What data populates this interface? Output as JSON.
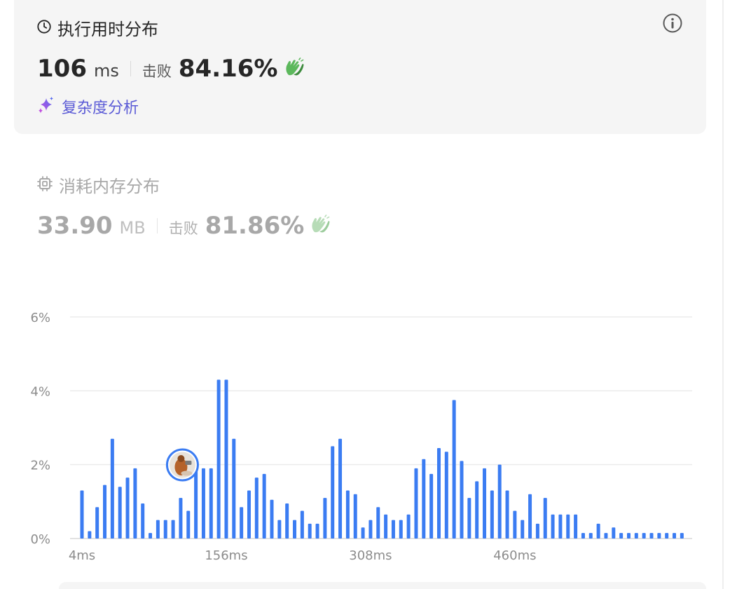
{
  "runtime": {
    "title": "执行用时分布",
    "value": "106",
    "unit": "ms",
    "beats_label": "击败",
    "beats_value": "84.16%",
    "analysis_label": "复杂度分析"
  },
  "memory": {
    "title": "消耗内存分布",
    "value": "33.90",
    "unit": "MB",
    "beats_label": "击败",
    "beats_value": "81.86%"
  },
  "colors": {
    "bar": "#3b7cf2",
    "accent_purple": "#7c5ce0",
    "clap_green": "#4caf50"
  },
  "icons": {
    "runtime": "clock-icon",
    "info": "info-icon",
    "analysis": "sparkle-icon",
    "memory": "chip-icon",
    "beats": "clapping-hands-icon",
    "marker": "user-avatar"
  },
  "chart_data": {
    "type": "bar",
    "title": "",
    "xlabel": "",
    "ylabel": "",
    "ylim": [
      0,
      6
    ],
    "yticks": [
      "0%",
      "2%",
      "4%",
      "6%"
    ],
    "xticks": [
      "4ms",
      "156ms",
      "308ms",
      "460ms"
    ],
    "x_tick_indices": [
      0,
      19,
      38,
      57
    ],
    "highlight_index": 13,
    "grid": true,
    "legend": "none",
    "series": [
      {
        "values": [
          1.3,
          0.2,
          0.85,
          1.45,
          2.7,
          1.4,
          1.65,
          1.9,
          0.95,
          0.15,
          0.5,
          0.5,
          0.5,
          1.1,
          0.75,
          2.05,
          1.9,
          1.9,
          4.3,
          4.3,
          2.7,
          0.85,
          1.3,
          1.65,
          1.75,
          1.05,
          0.5,
          0.95,
          0.5,
          0.75,
          0.4,
          0.4,
          1.1,
          2.5,
          2.7,
          1.3,
          1.2,
          0.3,
          0.5,
          0.85,
          0.65,
          0.5,
          0.5,
          0.65,
          1.9,
          2.15,
          1.75,
          2.45,
          2.35,
          3.75,
          2.1,
          1.1,
          1.55,
          1.9,
          1.3,
          2.0,
          1.3,
          0.75,
          0.5,
          1.2,
          0.4,
          1.1,
          0.65,
          0.65,
          0.65,
          0.65,
          0.15,
          0.15,
          0.4,
          0.15,
          0.3,
          0.15,
          0.15,
          0.15,
          0.15,
          0.15,
          0.15,
          0.15,
          0.15,
          0.15
        ]
      }
    ]
  }
}
